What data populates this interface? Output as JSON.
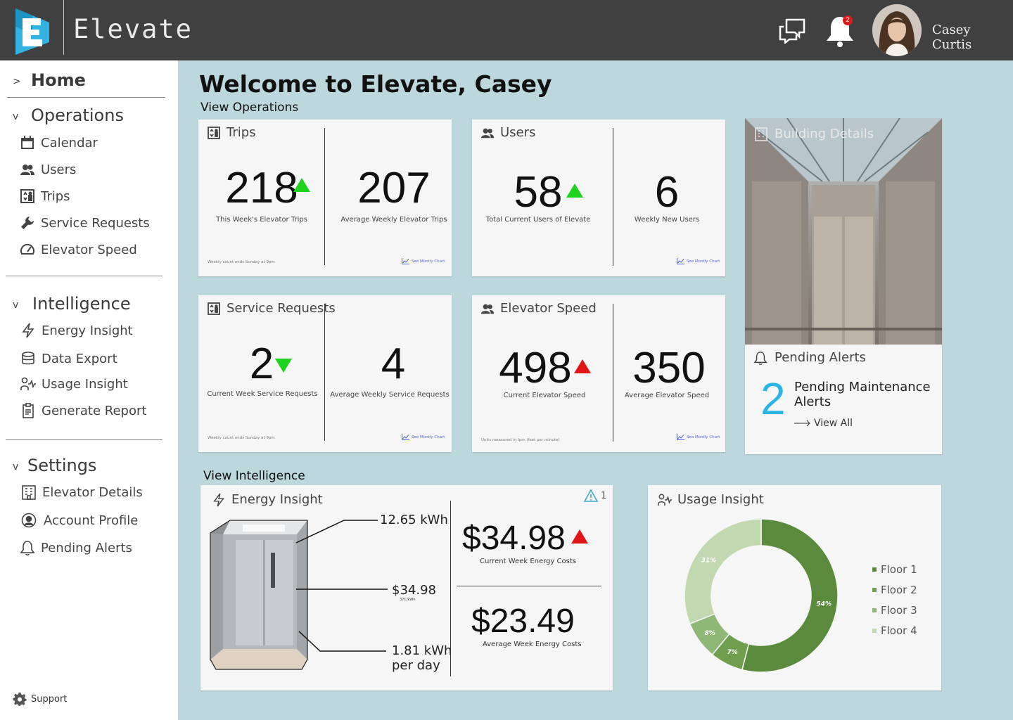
{
  "header": {
    "app_name": "Elevate",
    "notification_count": "2",
    "user_name": "Casey Curtis"
  },
  "sidebar": {
    "home": "Home",
    "sections": [
      {
        "title": "Operations",
        "items": [
          "Calendar",
          "Users",
          "Trips",
          "Service Requests",
          "Elevator Speed"
        ]
      },
      {
        "title": "Intelligence",
        "items": [
          "Energy Insight",
          "Data Export",
          "Usage Insight",
          "Generate Report"
        ]
      },
      {
        "title": "Settings",
        "items": [
          "Elevator Details",
          "Account Profile",
          "Pending Alerts"
        ]
      }
    ],
    "support": "Support",
    "chevron_closed": ">",
    "chevron_open": "v"
  },
  "main": {
    "welcome": "Welcome to Elevate, Casey",
    "view_operations": "View Operations",
    "view_intelligence": "View Intelligence"
  },
  "cards": {
    "trips": {
      "title": "Trips",
      "left_value": "218",
      "left_caption": "This Week's Elevator Trips",
      "left_trend": "up",
      "right_value": "207",
      "right_caption": "Average Weekly Elevator Trips",
      "footnote": "Weekly count ends Sunday at 9pm",
      "chart_link": "See Montly Chart"
    },
    "users": {
      "title": "Users",
      "left_value": "58",
      "left_caption": "Total Current Users of Elevate",
      "left_trend": "up",
      "right_value": "6",
      "right_caption": "Weekly New Users",
      "chart_link": "See Montly Chart"
    },
    "service": {
      "title": "Service Requests",
      "left_value": "2",
      "left_caption": "Current Week Service Requests",
      "left_trend": "down",
      "right_value": "4",
      "right_caption": "Average Weekly Service Requests",
      "footnote": "Weekly count ends Sunday at 9pm",
      "chart_link": "See Montly Chart"
    },
    "speed": {
      "title": "Elevator Speed",
      "left_value": "498",
      "left_caption": "Current Elevator Speed",
      "left_trend": "up",
      "right_value": "350",
      "right_caption": "Average Elevator Speed",
      "footnote": "Units measured in fpm (feet per minute)",
      "chart_link": "See Montly Chart"
    }
  },
  "building": {
    "title": "Building Details",
    "alerts_title": "Pending Alerts",
    "alerts_count": "2",
    "alerts_text": "Pending Maintenance Alerts",
    "view_all": "View All"
  },
  "energy": {
    "title": "Energy Insight",
    "warning_count": "1",
    "callout_top": "12.65 kWh",
    "callout_mid": "$34.98",
    "callout_mid_sub": "37C/kWh",
    "callout_bottom_1": "1.81 kWh",
    "callout_bottom_2": "per day",
    "current_cost": "$34.98",
    "current_cost_caption": "Current Week Energy Costs",
    "avg_cost": "$23.49",
    "avg_cost_caption": "Average Week Energy Costs"
  },
  "usage": {
    "title": "Usage Insight"
  },
  "colors": {
    "up_green": "#1ed31e",
    "up_red": "#e01515",
    "down_green": "#1ed31e",
    "accent_blue": "#2ab5e6",
    "floor1": "#5a8a3c",
    "floor2": "#6e9e4e",
    "floor3": "#8fb877",
    "floor4": "#c2d8b1"
  },
  "chart_data": {
    "type": "pie",
    "categories": [
      "Floor 1",
      "Floor 2",
      "Floor 3",
      "Floor 4"
    ],
    "values": [
      54,
      7,
      8,
      31
    ],
    "value_labels": [
      "54%",
      "7%",
      "8%",
      "31%"
    ],
    "donut": true,
    "legend": "right"
  }
}
